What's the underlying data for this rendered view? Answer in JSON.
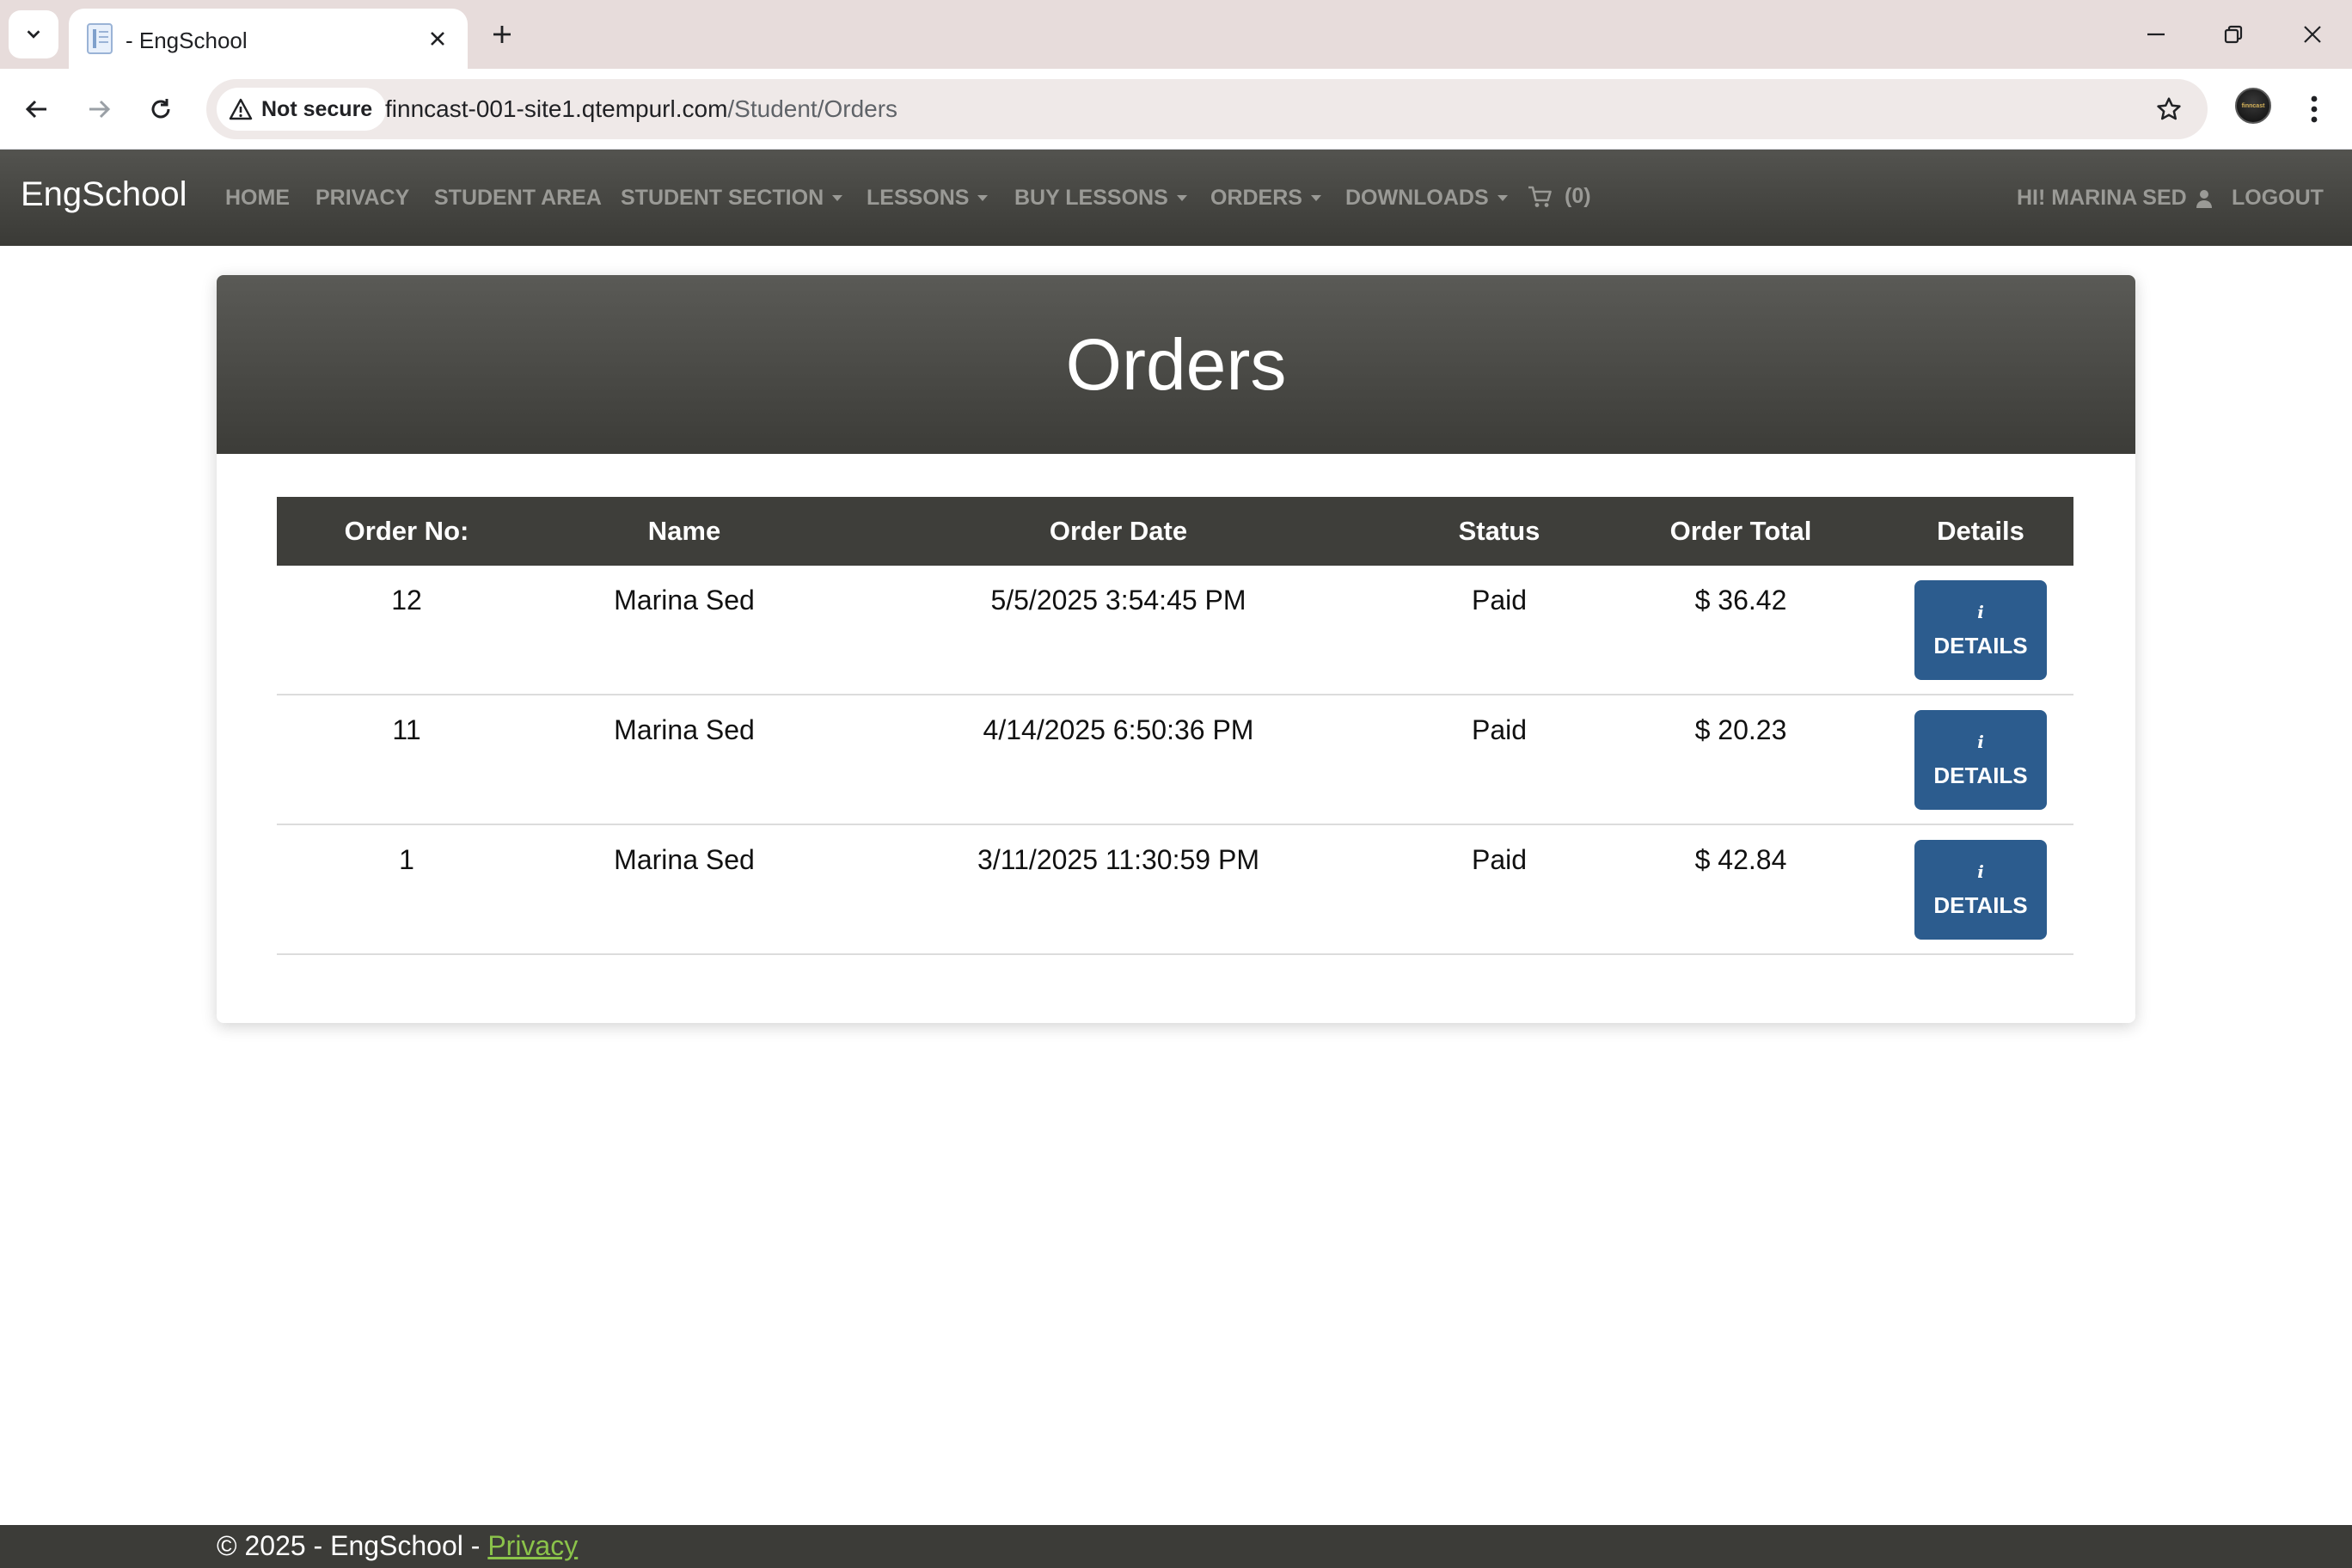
{
  "browser": {
    "tab_title": "- EngSchool",
    "security_label": "Not secure",
    "url_host": "finncast-001-site1.qtempurl.com",
    "url_path": "/Student/Orders",
    "profile_text": "finncast"
  },
  "navbar": {
    "brand": "EngSchool",
    "items": [
      {
        "label": "HOME"
      },
      {
        "label": "PRIVACY"
      },
      {
        "label": "STUDENT AREA"
      },
      {
        "label": "STUDENT SECTION"
      },
      {
        "label": "LESSONS"
      },
      {
        "label": "BUY LESSONS"
      },
      {
        "label": "ORDERS"
      },
      {
        "label": "DOWNLOADS"
      }
    ],
    "cart_count": "(0)",
    "greeting": "HI! MARINA SED",
    "logout": "LOGOUT"
  },
  "page": {
    "title": "Orders"
  },
  "table": {
    "columns": [
      "Order No:",
      "Name",
      "Order Date",
      "Status",
      "Order Total",
      "Details"
    ],
    "rows": [
      {
        "order_no": "12",
        "name": "Marina Sed",
        "date": "5/5/2025 3:54:45 PM",
        "status": "Paid",
        "total": "$ 36.42"
      },
      {
        "order_no": "11",
        "name": "Marina Sed",
        "date": "4/14/2025 6:50:36 PM",
        "status": "Paid",
        "total": "$ 20.23"
      },
      {
        "order_no": "1",
        "name": "Marina Sed",
        "date": "3/11/2025 11:30:59 PM",
        "status": "Paid",
        "total": "$ 42.84"
      }
    ],
    "details_icon": "i",
    "details_label": "DETAILS"
  },
  "footer": {
    "text": "© 2025 - EngSchool - ",
    "link": "Privacy"
  },
  "colors": {
    "navbar": "#3a3a36",
    "button": "#2c5c8e",
    "footer_link": "#8bc34a"
  }
}
